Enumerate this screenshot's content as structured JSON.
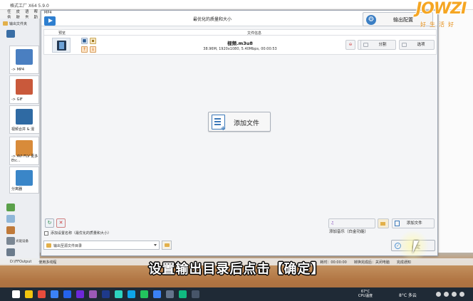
{
  "app": {
    "title": "格式工厂 X64 5.9.0",
    "menu": [
      "任务",
      "皮肤",
      "语言",
      "帮助"
    ],
    "output_folder_label": "输出文件夹",
    "tiles": [
      {
        "label": "-> MP4",
        "color": "#4a7fc1"
      },
      {
        "label": "-> GIF",
        "color": "#c9593b"
      },
      {
        "label": "视频合并 & 混",
        "color": "#2f6aa3"
      },
      {
        "label": "-> AVI FLV 更多 Etc...",
        "color": "#d88b3a"
      },
      {
        "label": "分离器",
        "color": "#3a86c8"
      }
    ],
    "left_more": "光驱设备"
  },
  "dialog": {
    "small_title": "MP4",
    "title": "最优化的质量和大小",
    "output_config_label": "输出配置",
    "columns": {
      "preview": "预览",
      "file_info": "文件信息"
    },
    "file": {
      "name": "视频.m3u8",
      "info": "38.96M, 1920x1080, 5.40Mbps, 00:00:53",
      "split_label": "分割",
      "options_label": "选项"
    },
    "add_file_center": "添加文件",
    "add_music_label": "添加音乐（白金功能）",
    "add_file_label": "添加文件",
    "checkbox_label": "添加设置名称（最优化的质量和大小）",
    "output_dir": "输出至源文件目录",
    "ok_label": "确定"
  },
  "statusbar": {
    "path": "D:\\FFOutput",
    "multithread": "使用多线程",
    "time": "耗时：00:00:00",
    "after": "转换完成后：关闭电脑",
    "notify": "完成通知"
  },
  "caption": "设置输出目录后点击【确定】",
  "watermark": {
    "logo": "JOWZI",
    "sub": "好生活好"
  },
  "taskbar": {
    "cpu_temp": "67°C",
    "cpu_label": "CPU温度",
    "weather": "8°C 多云",
    "icons": [
      "#ffffff",
      "#f1c40f",
      "#e74c3c",
      "#3b82f6",
      "#2563eb",
      "#6d28d9",
      "#9b59b6",
      "#1e3a8a",
      "#2dd4bf",
      "#0ea5e9",
      "#22c55e",
      "#3b82f6",
      "#64748b",
      "#10b981",
      "#475569"
    ]
  }
}
